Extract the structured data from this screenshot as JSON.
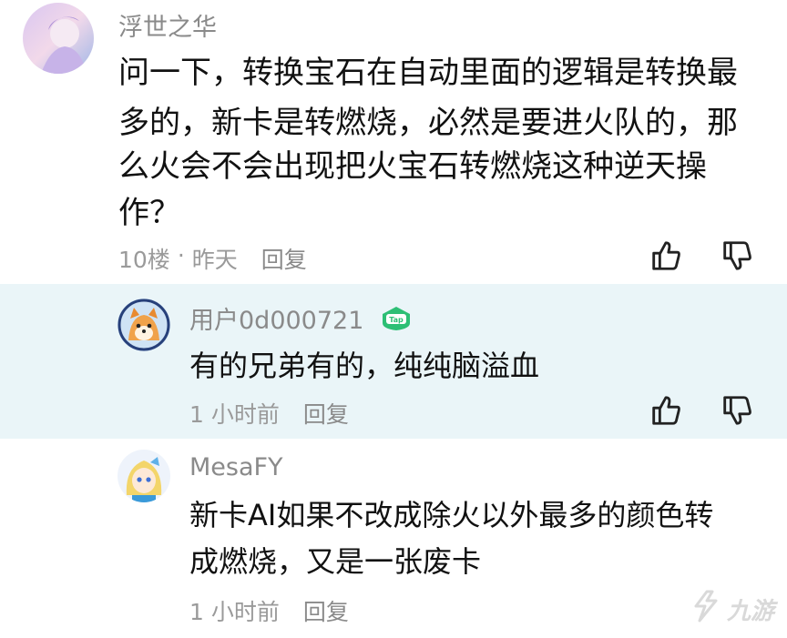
{
  "comments": [
    {
      "username": "浮世之华",
      "lines": [
        "问一下，转换宝石在自动里面的逻辑是转换最",
        "多的，新卡是转燃烧，必然是要进火队的，那",
        "么火会不会出现把火宝石转燃烧这种逆天操",
        "作？"
      ],
      "floor": "10楼",
      "separator": "·",
      "time": "昨天",
      "reply_label": "回复"
    },
    {
      "username": "用户0d000721",
      "badge_text": "Tap",
      "lines": [
        "有的兄弟有的，纯纯脑溢血"
      ],
      "time": "1 小时前",
      "reply_label": "回复"
    },
    {
      "username": "MesaFY",
      "lines": [
        "新卡AI如果不改成除火以外最多的颜色转",
        "成燃烧，又是一张废卡"
      ],
      "time": "1 小时前",
      "reply_label": "回复"
    }
  ],
  "watermark": {
    "text": "九游",
    "icon": "jiuyou-logo-icon"
  },
  "colors": {
    "reply_bg": "#eaf5f8",
    "badge": "#2dbf75",
    "muted": "#9a9a9a"
  },
  "icons": {
    "like": "thumbs-up-icon",
    "dislike": "thumbs-down-icon"
  }
}
